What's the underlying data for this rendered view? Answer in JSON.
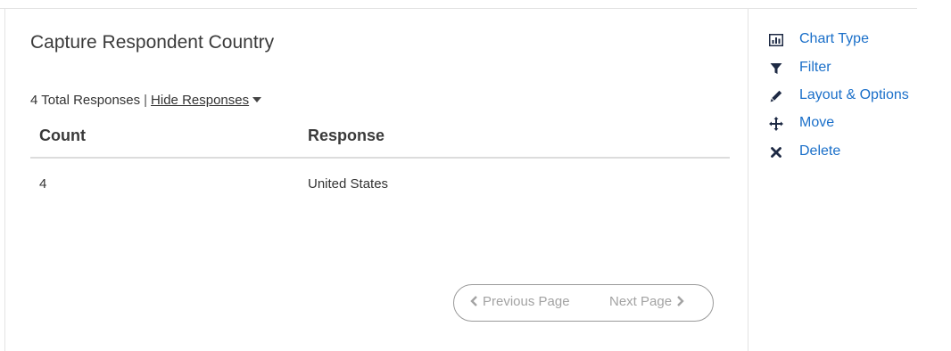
{
  "widget": {
    "title": "Capture Respondent Country",
    "total_responses": "4 Total Responses",
    "separator": "|",
    "toggle_label": "Hide Responses"
  },
  "table": {
    "columns": {
      "count": "Count",
      "response": "Response"
    },
    "rows": [
      {
        "count": "4",
        "response": "United States"
      }
    ]
  },
  "pagination": {
    "previous_label": "Previous Page",
    "next_label": "Next Page"
  },
  "actions": [
    {
      "label": "Chart Type",
      "icon": "bar-chart-icon"
    },
    {
      "label": "Filter",
      "icon": "filter-icon"
    },
    {
      "label": "Layout & Options",
      "icon": "pencil-icon"
    },
    {
      "label": "Move",
      "icon": "move-icon"
    },
    {
      "label": "Delete",
      "icon": "close-icon"
    }
  ],
  "colors": {
    "link": "#1a6fc9",
    "icon": "#1e2a44",
    "muted": "#a3a3a3"
  }
}
